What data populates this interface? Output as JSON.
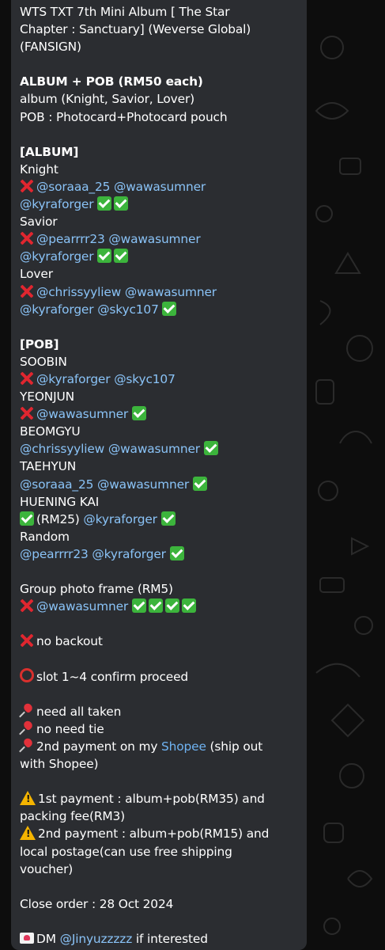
{
  "colors": {
    "background": "#0d0d0d",
    "bubble": "#2b2d31",
    "text": "#ffffff",
    "mention": "#8ac3f7",
    "link": "#6fb3f2"
  },
  "message": {
    "title_line1": "WTS TXT 7th Mini Album [ The Star",
    "title_line2": "Chapter : Sanctuary] (Weverse Global)",
    "title_line3": "(FANSIGN)",
    "price_heading": "ALBUM + POB (RM50 each)",
    "album_versions": "album (Knight, Savior, Lover)",
    "pob_desc": "POB : Photocard+Photocard pouch",
    "album_heading": "[ALBUM]",
    "knight": "Knight",
    "knight_a": "@soraaa_25",
    "knight_b": "@wawasumner",
    "knight_c": "@kyraforger",
    "savior": "Savior",
    "savior_a": "@pearrrr23",
    "savior_b": "@wawasumner",
    "savior_c": "@kyraforger",
    "lover": "Lover",
    "lover_a": "@chrissyyliew",
    "lover_b": "@wawasumner",
    "lover_c": "@kyraforger",
    "lover_d": "@skyc107",
    "pob_heading": "[POB]",
    "soobin": "SOOBIN",
    "soobin_a": "@kyraforger",
    "soobin_b": "@skyc107",
    "yeonjun": "YEONJUN",
    "yeonjun_a": "@wawasumner",
    "beomgyu": "BEOMGYU",
    "beomgyu_a": "@chrissyyliew",
    "beomgyu_b": "@wawasumner",
    "taehyun": "TAEHYUN",
    "taehyun_a": "@soraaa_25",
    "taehyun_b": "@wawasumner",
    "hueningkai": "HUENING KAI",
    "hk_price": "(RM25)",
    "hk_a": "@kyraforger",
    "random": "Random",
    "random_a": "@pearrrr23",
    "random_b": "@kyraforger",
    "frame": "Group photo frame (RM5)",
    "frame_a": "@wawasumner",
    "no_backout": "no backout",
    "slot_note": "slot 1~4 confirm proceed",
    "need_all": "need all taken",
    "no_tie": "no need tie",
    "pay2_prefix": "2nd payment on my ",
    "shopee": "Shopee",
    "pay2_suffix": " (ship out",
    "pay2_line2": "with Shopee)",
    "first_payment_l1": "1st payment : album+pob(RM35) and",
    "first_payment_l2": "packing fee(RM3)",
    "second_payment_l1": "2nd payment : album+pob(RM15) and",
    "second_payment_l2": "local postage(can use free shipping",
    "second_payment_l3": "voucher)",
    "close_order": "Close order : 28 Oct 2024",
    "dm_prefix": "DM ",
    "dm_handle": "@Jinyuzzzzz",
    "dm_suffix": " if interested"
  }
}
